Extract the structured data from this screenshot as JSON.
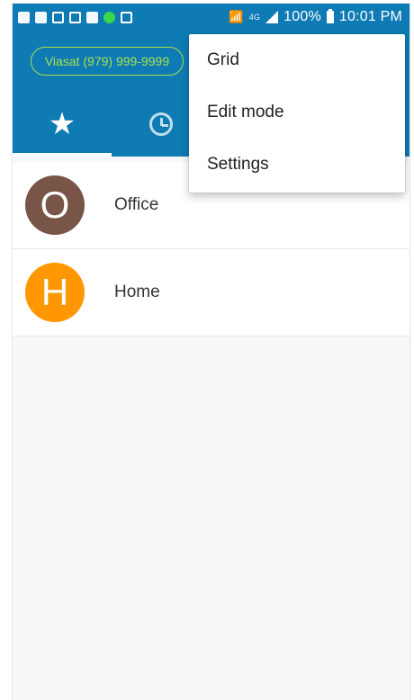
{
  "status_bar": {
    "battery_text": "100%",
    "time": "10:01 PM",
    "network_label": "4G"
  },
  "header": {
    "carrier_pill": "Viasat (979) 999-9999",
    "tabs": [
      {
        "icon": "star-icon",
        "selected": true
      },
      {
        "icon": "history-icon",
        "selected": false
      }
    ]
  },
  "contacts": [
    {
      "initial": "O",
      "name": "Office",
      "color": "#795548"
    },
    {
      "initial": "H",
      "name": "Home",
      "color": "#ff9800"
    }
  ],
  "menu": {
    "items": [
      "Grid",
      "Edit mode",
      "Settings"
    ]
  },
  "colors": {
    "header": "#0f7bb4",
    "accent_green": "#a6e04b"
  }
}
